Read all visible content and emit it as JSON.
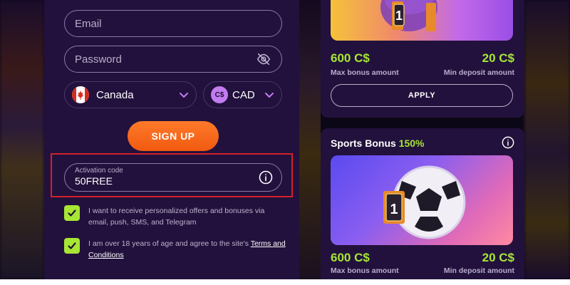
{
  "form": {
    "email_placeholder": "Email",
    "password_placeholder": "Password",
    "country": {
      "label": "Canada",
      "icon": "canada-flag-icon"
    },
    "currency": {
      "label": "CAD",
      "badge": "C$"
    },
    "signup_label": "SIGN UP",
    "activation": {
      "label": "Activation code",
      "value": "50FREE"
    },
    "checkboxes": [
      {
        "checked": true,
        "text": "I want to receive personalized offers and bonuses via email, push, SMS, and Telegram"
      },
      {
        "checked": true,
        "text": "I am over 18 years of age and agree to the site's ",
        "link": "Terms and Conditions"
      }
    ]
  },
  "cards": [
    {
      "badge_number": "1",
      "max_amount": "600 C$",
      "max_label": "Max bonus amount",
      "min_amount": "20 C$",
      "min_label": "Min deposit amount",
      "apply_label": "APPLY"
    },
    {
      "title": "Sports Bonus",
      "percent": "150%",
      "badge_number": "1",
      "max_amount": "600 C$",
      "max_label": "Max bonus amount",
      "min_amount": "20 C$",
      "min_label": "Min deposit amount"
    }
  ],
  "colors": {
    "panel": "#22113c",
    "accent_green": "#a7e635",
    "signup_orange": "#f56a1a",
    "highlight_red": "#d4202a"
  }
}
